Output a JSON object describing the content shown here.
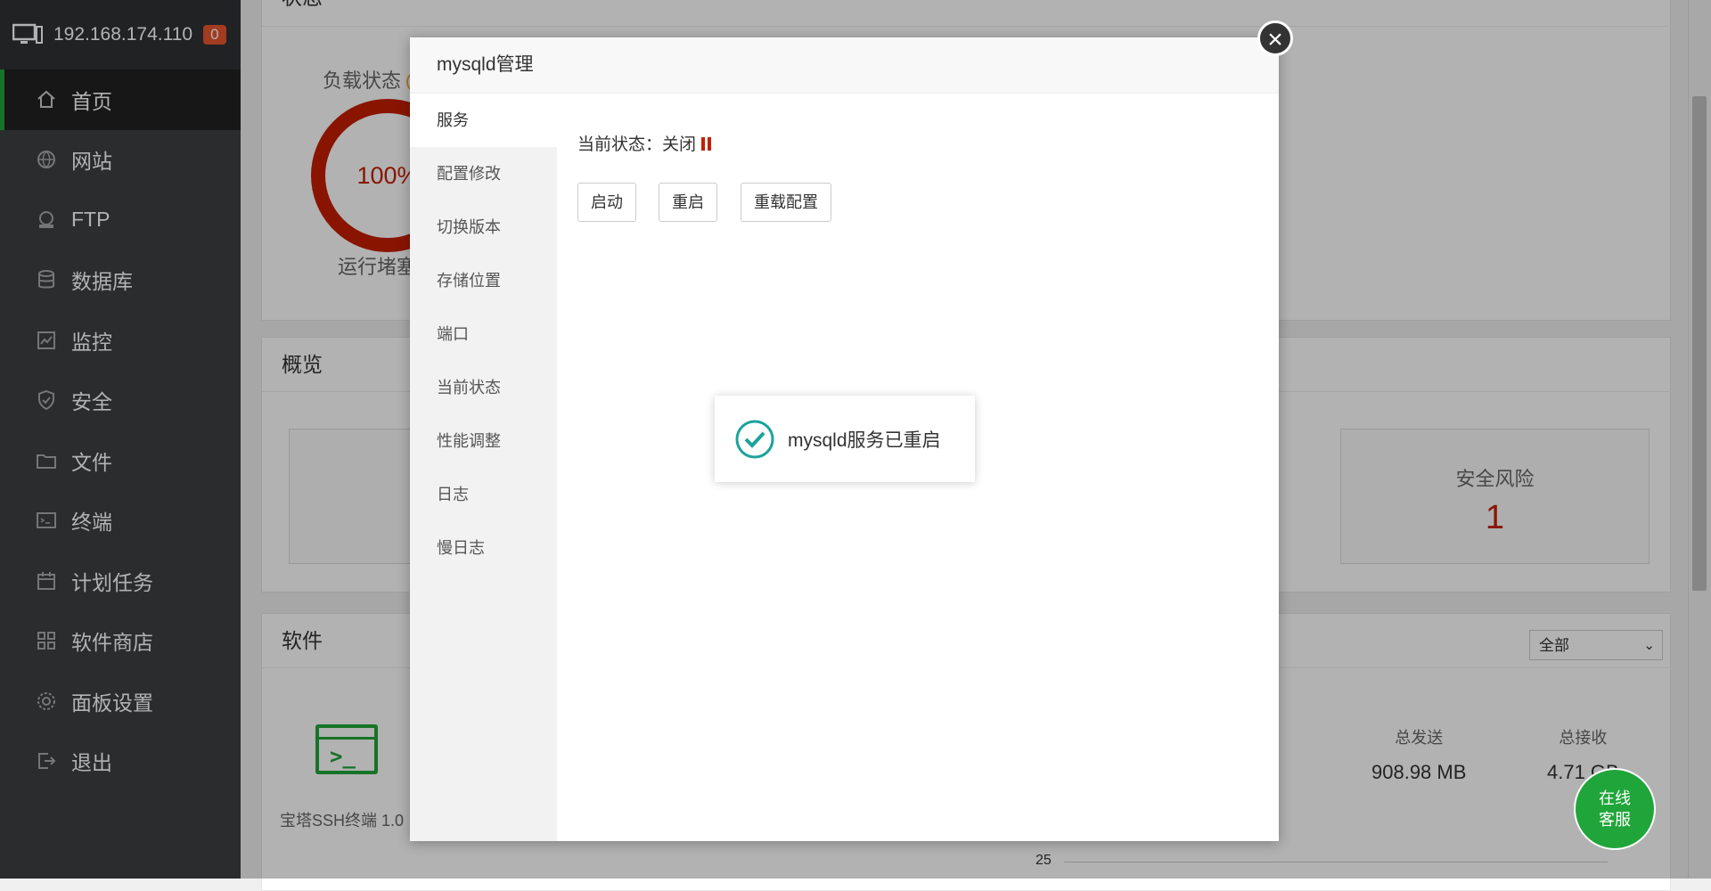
{
  "sidebar": {
    "host": "192.168.174.110",
    "badge": "0",
    "items": [
      {
        "label": "首页",
        "icon": "home-icon"
      },
      {
        "label": "网站",
        "icon": "globe-icon"
      },
      {
        "label": "FTP",
        "icon": "ftp-icon"
      },
      {
        "label": "数据库",
        "icon": "database-icon"
      },
      {
        "label": "监控",
        "icon": "monitor-icon"
      },
      {
        "label": "安全",
        "icon": "shield-icon"
      },
      {
        "label": "文件",
        "icon": "folder-icon"
      },
      {
        "label": "终端",
        "icon": "terminal-icon"
      },
      {
        "label": "计划任务",
        "icon": "calendar-icon"
      },
      {
        "label": "软件商店",
        "icon": "grid-icon"
      },
      {
        "label": "面板设置",
        "icon": "gear-icon"
      },
      {
        "label": "退出",
        "icon": "logout-icon"
      }
    ]
  },
  "status": {
    "title": "状态",
    "load_label": "负载状态",
    "help": "?",
    "load_value": "100%",
    "load_text": "运行堵塞"
  },
  "overview": {
    "title": "概览",
    "risk_label": "安全风险",
    "risk_value": "1"
  },
  "software": {
    "title": "软件",
    "filter": "全部",
    "ssh_label": "宝塔SSH终端 1.0",
    "total_send_label": "总发送",
    "total_send_value": "908.98 MB",
    "total_recv_label": "总接收",
    "total_recv_value": "4.71 GB",
    "axis_tick": "25"
  },
  "modal": {
    "title": "mysqld管理",
    "close": "×",
    "nav": [
      "服务",
      "配置修改",
      "切换版本",
      "存储位置",
      "端口",
      "当前状态",
      "性能调整",
      "日志",
      "慢日志"
    ],
    "status_label": "当前状态：",
    "status_value": "关闭",
    "buttons": {
      "start": "启动",
      "restart": "重启",
      "reload": "重载配置"
    }
  },
  "toast": {
    "message": "mysqld服务已重启"
  },
  "service": {
    "line1": "在线",
    "line2": "客服"
  },
  "colors": {
    "accent": "#20a53a",
    "danger": "#c41f00"
  }
}
